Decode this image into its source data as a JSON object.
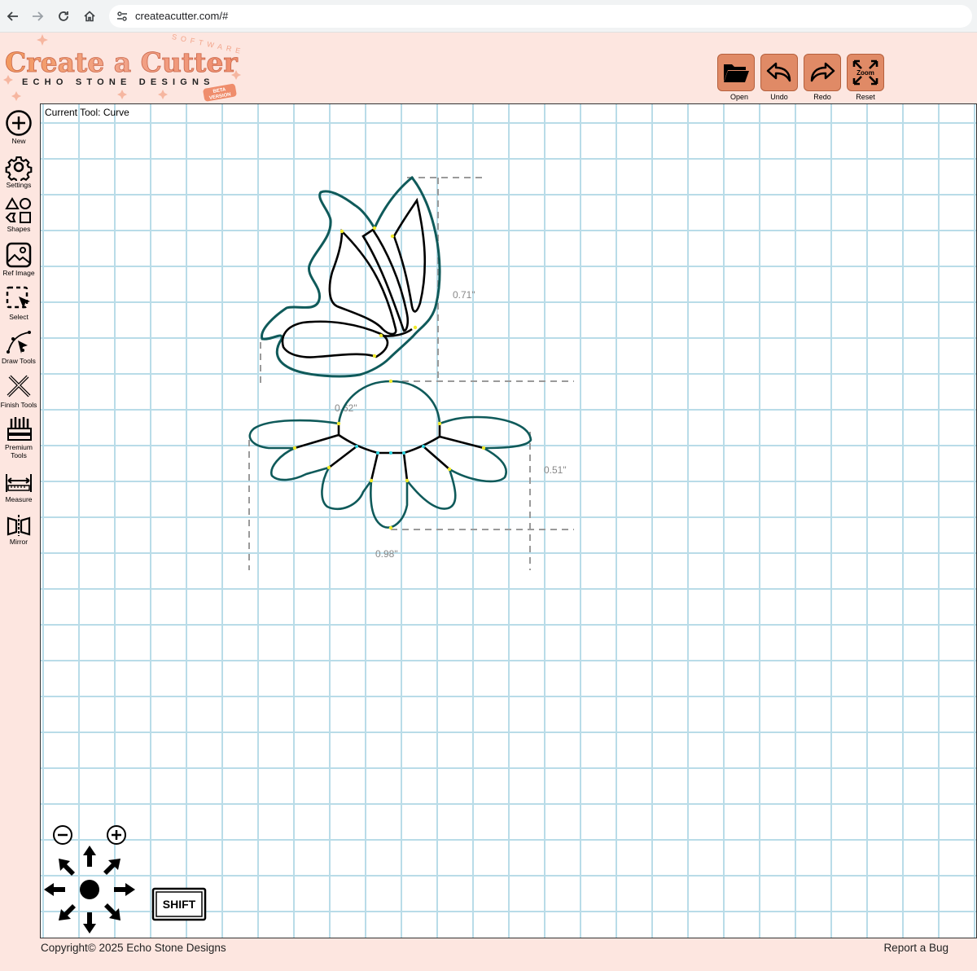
{
  "browser": {
    "url": "createacutter.com/#",
    "back_icon": "back-arrow-icon",
    "forward_icon": "forward-arrow-icon",
    "reload_icon": "reload-icon",
    "home_icon": "home-icon"
  },
  "logo": {
    "title": "Create a Cutter",
    "subtitle": "ECHO STONE DESIGNS",
    "arc_text": "SOFTWARE",
    "badge_top": "BETA",
    "badge_bottom": "VERSION"
  },
  "toolbar": [
    {
      "label": "Open",
      "icon": "folder-icon"
    },
    {
      "label": "Undo",
      "icon": "undo-icon"
    },
    {
      "label": "Redo",
      "icon": "redo-icon"
    },
    {
      "label": "Reset",
      "icon": "zoom-reset-icon",
      "icon_text": "Zoom"
    }
  ],
  "sidebar": [
    {
      "label": "New",
      "icon": "plus-circle-icon"
    },
    {
      "label": "Settings",
      "icon": "gear-icon"
    },
    {
      "label": "Shapes",
      "icon": "shapes-icon"
    },
    {
      "label": "Ref Image",
      "icon": "image-icon"
    },
    {
      "label": "Select",
      "icon": "select-icon"
    },
    {
      "label": "Draw Tools",
      "icon": "pen-tool-icon"
    },
    {
      "label": "Finish Tools",
      "icon": "finish-tools-icon"
    },
    {
      "label": "Premium Tools",
      "icon": "premium-tools-icon"
    },
    {
      "label": "Measure",
      "icon": "ruler-icon"
    },
    {
      "label": "Mirror",
      "icon": "mirror-icon"
    }
  ],
  "canvas": {
    "current_tool": "Current Tool: Curve",
    "measurements": [
      "0.71\"",
      "0.62\"",
      "0.51\"",
      "0.98\""
    ],
    "accent": "#0f5a5a"
  },
  "controls": {
    "zoom_out_icon": "zoom-out-icon",
    "zoom_in_icon": "zoom-in-icon",
    "pan_icon": "pan-arrows-icon",
    "shift_key": "SHIFT"
  },
  "footer": {
    "copyright": "Copyright© 2025 Echo Stone Designs",
    "report": "Report a Bug"
  }
}
